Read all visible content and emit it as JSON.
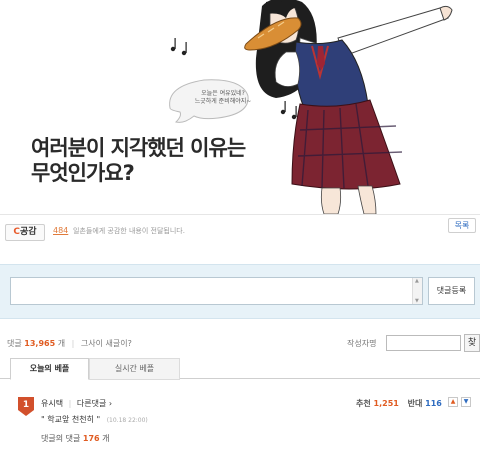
{
  "banner": {
    "speech_bubble": [
      "오늘은 여유있네?",
      "느긋하게 준비해야지~"
    ],
    "headline": [
      "여러분이 지각했던 이유는",
      "무엇인가요?"
    ]
  },
  "like_bar": {
    "button_prefix": "C",
    "button_label": "공감",
    "count": "484",
    "description": "일촌들에게 공감한 내용이 전달됩니다.",
    "list_button": "목록"
  },
  "comment_form": {
    "placeholder": "",
    "submit_label": "댓글등록"
  },
  "comment_stats": {
    "prefix": "댓글",
    "count": "13,965",
    "unit": "개",
    "new_check": "그사이 새글이?",
    "author_label": "작성자명",
    "author_search_button": "찾"
  },
  "tabs": [
    {
      "label": "오늘의 베플",
      "active": true
    },
    {
      "label": "실시간 베플",
      "active": false
    }
  ],
  "best_comment": {
    "rank": "1",
    "author": "유시택",
    "other_comments": "다른댓글 ›",
    "text": "\" 학교앞 천천히 \"",
    "timestamp": "(10.18 22:00)",
    "recommend_label": "추천",
    "recommend_count": "1,251",
    "oppose_label": "반대",
    "oppose_count": "116",
    "replies_label": "댓글의 댓글",
    "replies_count": "176",
    "replies_unit": "개"
  },
  "colors": {
    "accent_orange": "#e05c22",
    "link_blue": "#2f6cc0",
    "input_bg": "#e7f2f8"
  },
  "icons": [
    "music-note-icon",
    "rank-badge-icon",
    "thumb-up-arrow-icon",
    "thumb-down-arrow-icon"
  ]
}
